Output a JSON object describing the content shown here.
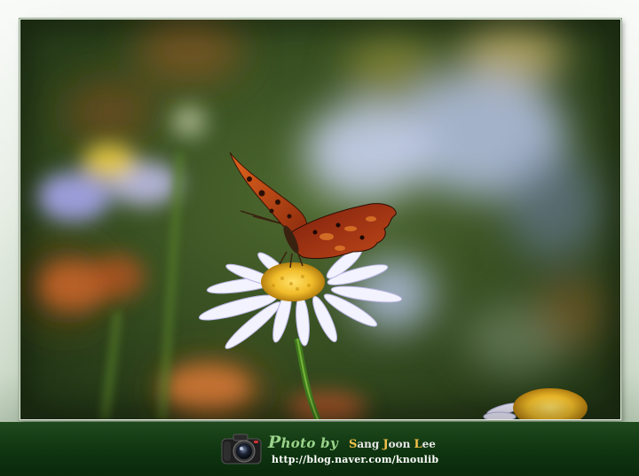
{
  "photo": {
    "subject": "butterfly-on-daisy",
    "icon": "butterfly-icon"
  },
  "credit": {
    "photo_by_first": "P",
    "photo_by_rest": "hoto by",
    "author_parts": [
      {
        "initial": "S",
        "rest": "ang"
      },
      {
        "initial": "J",
        "rest": "oon"
      },
      {
        "initial": "L",
        "rest": "ee"
      }
    ],
    "url": "http://blog.naver.com/knoulib",
    "icon": "camera-icon"
  },
  "colors": {
    "caption_bar": "#0f3510",
    "photo_by": "#9ad38a",
    "author_initial": "#f2c14a"
  }
}
